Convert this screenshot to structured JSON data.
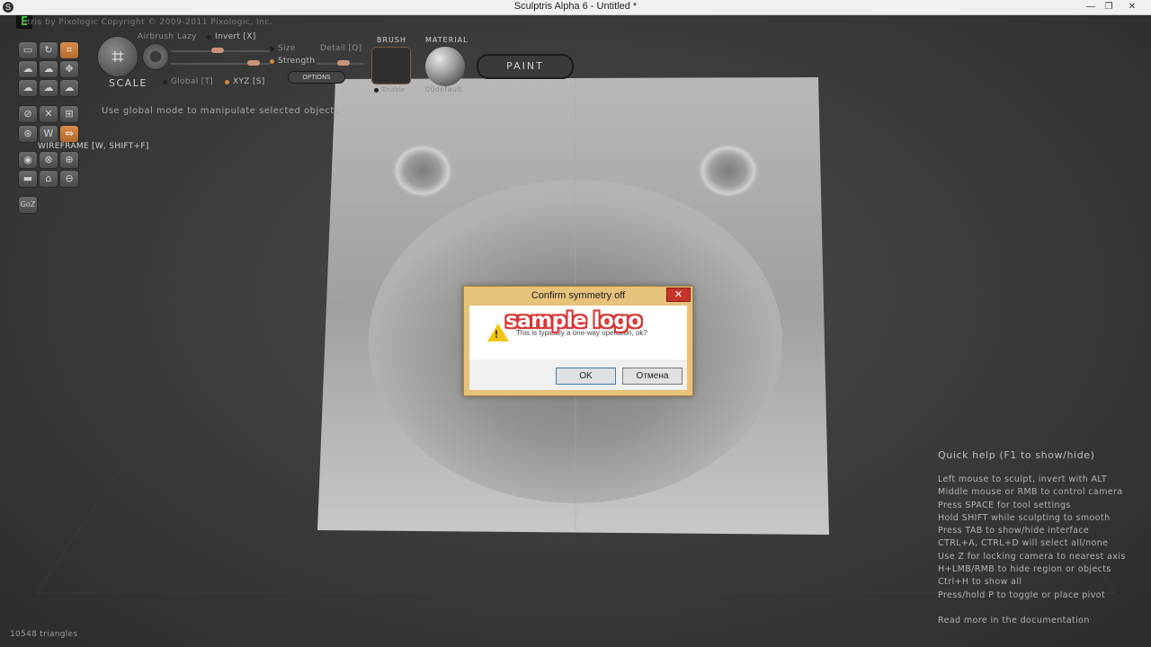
{
  "window": {
    "title": "Sculptris Alpha 6 - Untitled *",
    "app_icon": "S",
    "minimize": "—",
    "maximize": "❐",
    "close": "✕"
  },
  "badge": "E",
  "copyright": "ptris by Pixologic   Copyright © 2009-2011 Pixologic, Inc.",
  "toolbar": {
    "scale_label": "SCALE",
    "airbrush_label": "Airbrush",
    "lazy_label": "Lazy",
    "invert_label": "Invert [X]",
    "size_label": "Size",
    "detail_label": "Detail [Q]",
    "strength_label": "Strength",
    "global_label": "Global [T]",
    "xyz_label": "XYZ [S]",
    "options_label": "OPTIONS",
    "brush_header": "BRUSH",
    "material_header": "MATERIAL",
    "enable_label": "Enable",
    "material_name": "00default",
    "paint_label": "PAINT"
  },
  "hint": "Use global mode to manipulate selected objects",
  "wireframe_label": "WIREFRAME [W, SHIFT+F]",
  "goz_label": "GoZ",
  "quick_help": {
    "title": "Quick help (F1 to show/hide)",
    "items": [
      "Left mouse to sculpt, invert with ALT",
      "Middle mouse or RMB to control camera",
      "Press SPACE for tool settings",
      "Hold SHIFT while sculpting to smooth",
      "Press TAB to show/hide interface",
      "CTRL+A, CTRL+D will select all/none",
      "Use Z for locking camera to nearest axis",
      "H+LMB/RMB to hide region or objects",
      "Ctrl+H to show all",
      "Press/hold P to toggle or place pivot"
    ],
    "more": "Read more in the documentation"
  },
  "status": {
    "triangles": "10548 triangles"
  },
  "dialog": {
    "title": "Confirm symmetry off",
    "close": "✕",
    "message": "This is typically a one-way operation, ok?",
    "watermark": "sample logo",
    "ok_label": "OK",
    "cancel_label": "Отмена",
    "warn_mark": "!"
  }
}
